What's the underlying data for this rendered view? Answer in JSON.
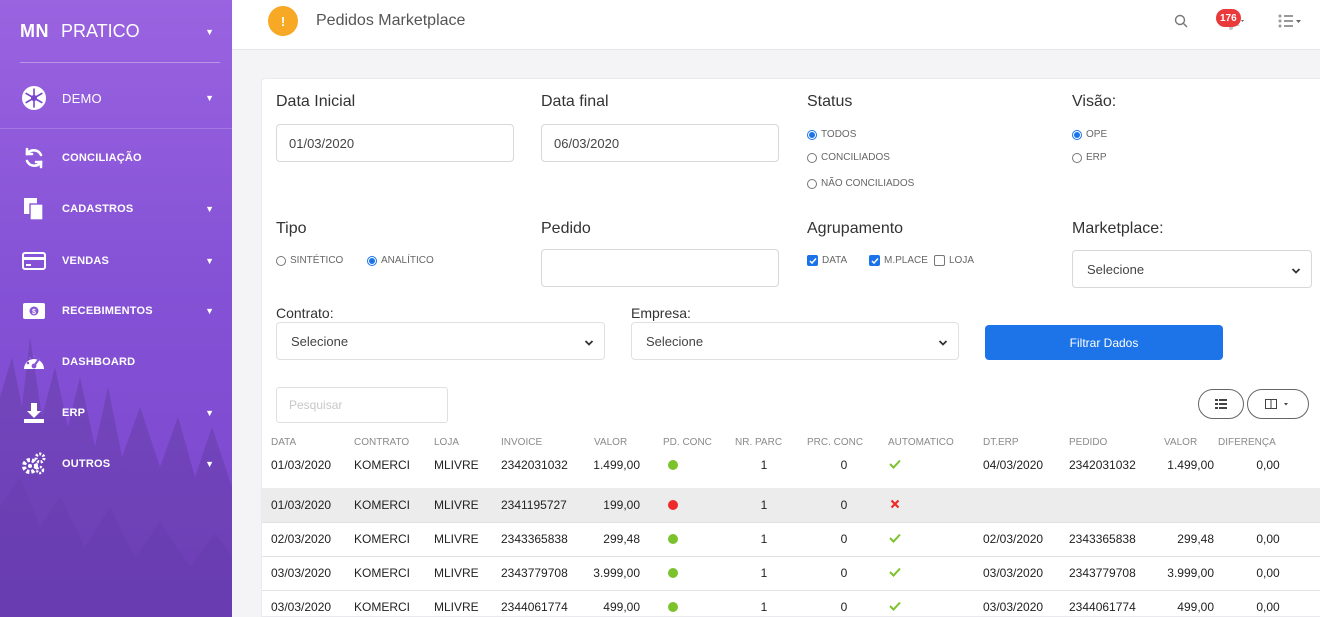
{
  "sidebar": {
    "brand_logo": "MN",
    "brand_name": "PRATICO",
    "items": [
      {
        "label": "DEMO",
        "icon": "snowflake-icon",
        "has_caret": true
      },
      {
        "label": "CONCILIAÇÃO",
        "icon": "sync-icon",
        "has_caret": false
      },
      {
        "label": "CADASTROS",
        "icon": "documents-icon",
        "has_caret": true
      },
      {
        "label": "VENDAS",
        "icon": "credit-card-icon",
        "has_caret": true
      },
      {
        "label": "RECEBIMENTOS",
        "icon": "money-icon",
        "has_caret": true
      },
      {
        "label": "DASHBOARD",
        "icon": "gauge-icon",
        "has_caret": false
      },
      {
        "label": "ERP",
        "icon": "download-icon",
        "has_caret": true
      },
      {
        "label": "OUTROS",
        "icon": "gears-icon",
        "has_caret": true
      }
    ]
  },
  "topbar": {
    "badge_symbol": "!",
    "title": "Pedidos Marketplace",
    "notification_count": "176"
  },
  "filters": {
    "data_inicial_label": "Data Inicial",
    "data_inicial_value": "01/03/2020",
    "data_final_label": "Data final",
    "data_final_value": "06/03/2020",
    "status_label": "Status",
    "status_options": [
      "TODOS",
      "CONCILIADOS",
      "NÃO CONCILIADOS"
    ],
    "status_selected": "TODOS",
    "visao_label": "Visão:",
    "visao_options": [
      "OPE",
      "ERP"
    ],
    "visao_selected": "OPE",
    "tipo_label": "Tipo",
    "tipo_options": [
      "SINTÉTICO",
      "ANALÍTICO"
    ],
    "tipo_selected": "ANALÍTICO",
    "pedido_label": "Pedido",
    "pedido_value": "",
    "agrupamento_label": "Agrupamento",
    "agrupamento_options": [
      "DATA",
      "M.PLACE",
      "LOJA"
    ],
    "agrupamento_checked": [
      "DATA",
      "M.PLACE"
    ],
    "marketplace_label": "Marketplace:",
    "marketplace_value": "Selecione",
    "contrato_label": "Contrato:",
    "contrato_value": "Selecione",
    "empresa_label": "Empresa:",
    "empresa_value": "Selecione",
    "filter_button": "Filtrar Dados"
  },
  "table": {
    "search_placeholder": "Pesquisar",
    "columns": [
      "DATA",
      "CONTRATO",
      "LOJA",
      "INVOICE",
      "VALOR",
      "PD. CONC",
      "NR. PARC",
      "PRC. CONC",
      "AUTOMATICO",
      "DT.ERP",
      "PEDIDO",
      "VALOR",
      "DIFERENÇA"
    ],
    "rows": [
      {
        "data": "01/03/2020",
        "contrato": "KOMERCI",
        "loja": "MLIVRE",
        "invoice": "2342031032",
        "valor": "1.499,00",
        "pd_conc": "green",
        "nr_parc": "1",
        "prc_conc": "0",
        "automatico": "check",
        "dt_erp": "04/03/2020",
        "pedido": "2342031032",
        "valor_erp": "1.499,00",
        "diferenca": "0,00"
      },
      {
        "data": "01/03/2020",
        "contrato": "KOMERCI",
        "loja": "MLIVRE",
        "invoice": "2341195727",
        "valor": "199,00",
        "pd_conc": "red",
        "nr_parc": "1",
        "prc_conc": "0",
        "automatico": "cross",
        "dt_erp": "",
        "pedido": "",
        "valor_erp": "",
        "diferenca": ""
      },
      {
        "data": "02/03/2020",
        "contrato": "KOMERCI",
        "loja": "MLIVRE",
        "invoice": "2343365838",
        "valor": "299,48",
        "pd_conc": "green",
        "nr_parc": "1",
        "prc_conc": "0",
        "automatico": "check",
        "dt_erp": "02/03/2020",
        "pedido": "2343365838",
        "valor_erp": "299,48",
        "diferenca": "0,00"
      },
      {
        "data": "03/03/2020",
        "contrato": "KOMERCI",
        "loja": "MLIVRE",
        "invoice": "2343779708",
        "valor": "3.999,00",
        "pd_conc": "green",
        "nr_parc": "1",
        "prc_conc": "0",
        "automatico": "check",
        "dt_erp": "03/03/2020",
        "pedido": "2343779708",
        "valor_erp": "3.999,00",
        "diferenca": "0,00"
      },
      {
        "data": "03/03/2020",
        "contrato": "KOMERCI",
        "loja": "MLIVRE",
        "invoice": "2344061774",
        "valor": "499,00",
        "pd_conc": "green",
        "nr_parc": "1",
        "prc_conc": "0",
        "automatico": "check",
        "dt_erp": "03/03/2020",
        "pedido": "2344061774",
        "valor_erp": "499,00",
        "diferenca": "0,00"
      }
    ]
  },
  "colors": {
    "sidebar": "#8a56d9",
    "primary": "#1d74e9",
    "badge_orange": "#f7a825",
    "status_green": "#7cc22d",
    "status_red": "#ee2a2a",
    "notification_red": "#e9393b"
  }
}
